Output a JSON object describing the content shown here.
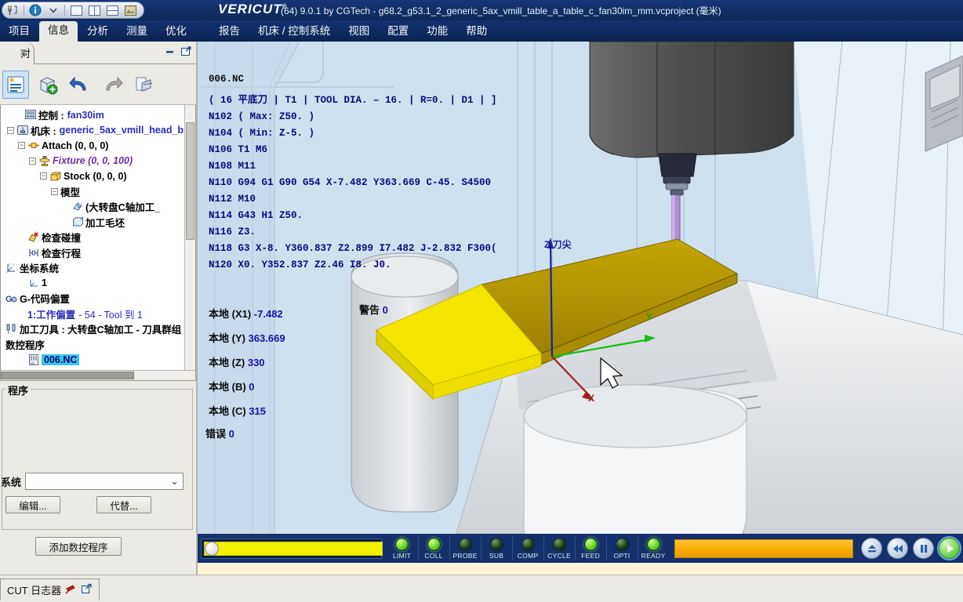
{
  "titlebar": {
    "brand": "VERICUT",
    "brand_tm": "®",
    "title": "(64)  9.0.1 by CGTech - g68.2_g53.1_2_generic_5ax_vmill_table_a_table_c_fan30im_mm.vcproject (毫米)",
    "qat_icons": [
      "machine-tool-icon",
      "info-icon",
      "chevron-down-icon",
      "single-pane-icon",
      "split-vertical-icon",
      "split-horizontal-icon",
      "render-view-icon"
    ]
  },
  "menubar": {
    "items": [
      {
        "label": "项目",
        "active": false
      },
      {
        "label": "信息",
        "active": true
      },
      {
        "label": "分析",
        "active": false
      },
      {
        "label": "测量",
        "active": false
      },
      {
        "label": "优化",
        "active": false
      },
      {
        "label": "报告",
        "active": false
      },
      {
        "label": "机床 / 控制系统",
        "active": false
      },
      {
        "label": "视图",
        "active": false
      },
      {
        "label": "配置",
        "active": false
      },
      {
        "label": "功能",
        "active": false
      },
      {
        "label": "帮助",
        "active": false
      }
    ]
  },
  "leftpanel": {
    "tab_label": "对",
    "close_glyph": "✕",
    "minimize_glyph": "▬",
    "restore_glyph": "⧉",
    "toolstrip_icons": [
      "project-tree-icon",
      "add-component-icon",
      "undo-icon",
      "redo-icon",
      "export-icon"
    ],
    "tree": [
      {
        "indent": 1,
        "exp": "",
        "icon": "control-icon",
        "style": "bold",
        "label": "控制 :",
        "value": "fan30im"
      },
      {
        "indent": 1,
        "exp": "-",
        "icon": "machine-icon",
        "style": "bold",
        "label": "机床 :",
        "value": "generic_5ax_vmill_head_b"
      },
      {
        "indent": 2,
        "exp": "-",
        "icon": "attach-icon",
        "style": "plain",
        "label": "Attach (0, 0, 0)",
        "value": ""
      },
      {
        "indent": 3,
        "exp": "-",
        "icon": "fixture-icon",
        "style": "purple",
        "label": "Fixture (0, 0, 100)",
        "value": ""
      },
      {
        "indent": 4,
        "exp": "-",
        "icon": "stock-icon",
        "style": "plain",
        "label": "Stock (0, 0, 0)",
        "value": ""
      },
      {
        "indent": 5,
        "exp": "-",
        "icon": "model-icon",
        "style": "bold",
        "label": "模型",
        "value": ""
      },
      {
        "indent": 6,
        "exp": "",
        "icon": "solid-model-icon",
        "style": "bold",
        "label": "(大转盘C轴加工_",
        "value": ""
      },
      {
        "indent": 6,
        "exp": "",
        "icon": "block-icon",
        "style": "bold",
        "label": "加工毛坯",
        "value": ""
      },
      {
        "indent": 2,
        "exp": "",
        "icon": "collision-icon",
        "style": "bold",
        "label": "检查碰撞",
        "value": ""
      },
      {
        "indent": 2,
        "exp": "",
        "icon": "travel-icon",
        "style": "bold",
        "label": "检查行程",
        "value": ""
      },
      {
        "indent": 0,
        "exp": "",
        "icon": "csys-icon",
        "style": "bold",
        "label": "坐标系统",
        "value": ""
      },
      {
        "indent": 1,
        "exp": "",
        "icon": "csys-small-icon",
        "style": "bold",
        "label": "1",
        "value": ""
      },
      {
        "indent": 0,
        "exp": "",
        "icon": "gcode-offset-icon",
        "style": "bold",
        "label": "G-代码偏置",
        "value": ""
      },
      {
        "indent": 1,
        "exp": "",
        "icon": "",
        "style": "offset",
        "label": "1:工作偏置",
        "value": "- 54 - Tool 到 1"
      },
      {
        "indent": 0,
        "exp": "",
        "icon": "toolbar-icon",
        "style": "bold",
        "label": "加工刀具 : 大转盘C轴加工 - 刀具群组 -",
        "value": ""
      },
      {
        "indent": 0,
        "exp": "",
        "icon": "",
        "style": "bold",
        "label": "数控程序",
        "value": ""
      },
      {
        "indent": 1,
        "exp": "",
        "icon": "nc-file-icon",
        "style": "selected",
        "label": "006.NC",
        "value": ""
      }
    ],
    "groupbox": {
      "title": "程序",
      "field_label": "系统",
      "combo_value": "",
      "combo_caret": "⌄",
      "buttons": [
        "编辑...",
        "代替..."
      ],
      "add_button": "添加数控程序"
    }
  },
  "viewport": {
    "gcode_title": "006.NC",
    "gcode_lines": [
      "(  16  平底刀  |  T1  |  TOOL  DIA.  –  16.  |  R=0.  |  D1  |  ]",
      "N102  ( Max:    Z50.  )",
      "N104  ( Min:    Z-5.  )",
      "N106  T1  M6",
      "N108  M11",
      "N110  G94  G1  G90  G54  X-7.482  Y363.669  C-45.  S4500",
      "N112  M10",
      "N114  G43  H1  Z50.",
      "N116  Z3.",
      "N118  G3  X-8.  Y360.837  Z2.899  I7.482  J-2.832  F300(",
      "N120  X0.  Y352.837  Z2.46  I8.  J0."
    ],
    "status": [
      {
        "label": "本地 (X1)",
        "value": "-7.482"
      },
      {
        "label": "本地 (Y)",
        "value": "363.669"
      },
      {
        "label": "本地 (Z)",
        "value": "330"
      },
      {
        "label": "本地 (B)",
        "value": "0"
      },
      {
        "label": "本地 (C)",
        "value": "315"
      }
    ],
    "warning_label": "警告",
    "warning_value": "0",
    "error_label": "错误",
    "error_value": "0",
    "axes": [
      {
        "name": "z-axis-label",
        "label": "Z 刀尖",
        "color": "#2323a0"
      },
      {
        "name": "y-axis-label",
        "label": "Y",
        "color": "#10a010"
      },
      {
        "name": "x-axis-label",
        "label": "X",
        "color": "#a01010"
      }
    ]
  },
  "statusbar": {
    "progress_percent": 100,
    "lamps": [
      {
        "label": "LIMIT",
        "state": "on"
      },
      {
        "label": "COLL",
        "state": "on"
      },
      {
        "label": "PROBE",
        "state": "off"
      },
      {
        "label": "SUB",
        "state": "off"
      },
      {
        "label": "COMP",
        "state": "off"
      },
      {
        "label": "CYCLE",
        "state": "off"
      },
      {
        "label": "FEED",
        "state": "on"
      },
      {
        "label": "OPTI",
        "state": "off"
      },
      {
        "label": "READY",
        "state": "on"
      }
    ],
    "controls": [
      {
        "name": "reset-button",
        "glyph": "eject"
      },
      {
        "name": "rewind-button",
        "glyph": "rewind"
      },
      {
        "name": "pause-button",
        "glyph": "pause"
      },
      {
        "name": "play-button",
        "glyph": "play"
      }
    ]
  },
  "bottombar": {
    "log_tab": "CUT 日志器",
    "pin_icon": "pin-icon",
    "popout_icon": "popout-icon"
  },
  "colors": {
    "title_blue": "#113068",
    "menu_blue": "#0f2a60",
    "panel_gray": "#eceae4",
    "viewport_bg": "#cfe0ef",
    "stock_gold": "#b39703",
    "stock_yellow": "#f5e400",
    "selection_cyan": "#35c6f0",
    "progress_yellow": "#f2f200",
    "orange_bar": "#f5a800"
  }
}
